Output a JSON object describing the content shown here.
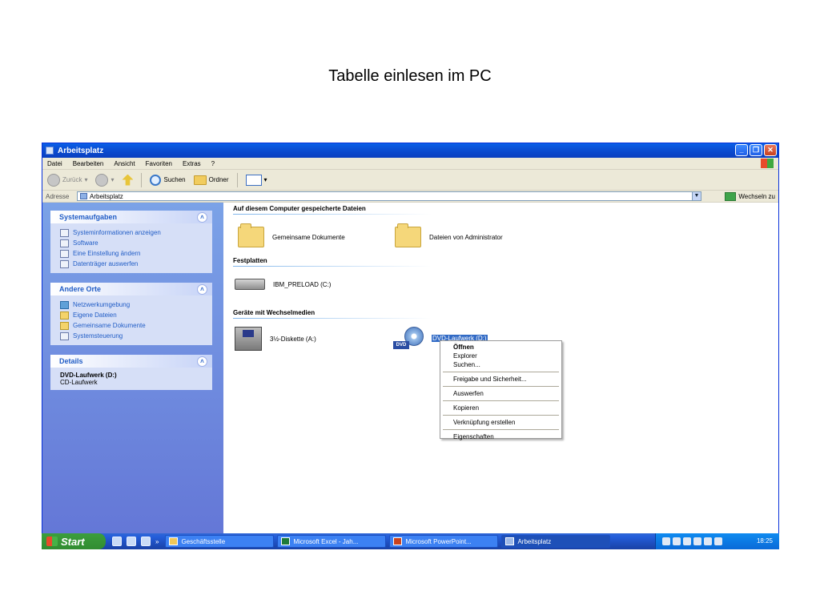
{
  "slide": {
    "title": "Tabelle einlesen im PC"
  },
  "window": {
    "title": "Arbeitsplatz",
    "menu": [
      "Datei",
      "Bearbeiten",
      "Ansicht",
      "Favoriten",
      "Extras",
      "?"
    ],
    "toolbar": {
      "back": "Zurück",
      "search": "Suchen",
      "folders": "Ordner"
    },
    "address": {
      "label": "Adresse",
      "value": "Arbeitsplatz",
      "go": "Wechseln zu"
    }
  },
  "sidebar": {
    "system_tasks": {
      "title": "Systemaufgaben",
      "items": [
        "Systeminformationen anzeigen",
        "Software",
        "Eine Einstellung ändern",
        "Datenträger auswerfen"
      ]
    },
    "other_places": {
      "title": "Andere Orte",
      "items": [
        "Netzwerkumgebung",
        "Eigene Dateien",
        "Gemeinsame Dokumente",
        "Systemsteuerung"
      ]
    },
    "details": {
      "title": "Details",
      "name": "DVD-Laufwerk (D:)",
      "type": "CD-Laufwerk"
    }
  },
  "content": {
    "groups": [
      {
        "title": "Auf diesem Computer gespeicherte Dateien",
        "items": [
          "Gemeinsame Dokumente",
          "Dateien von Administrator"
        ]
      },
      {
        "title": "Festplatten",
        "items": [
          "IBM_PRELOAD (C:)"
        ]
      },
      {
        "title": "Geräte mit Wechselmedien",
        "items": [
          "3½-Diskette (A:)",
          "DVD-Laufwerk (D:)"
        ]
      }
    ],
    "dvd_badge": "DVD"
  },
  "context_menu": {
    "items": [
      "Öffnen",
      "Explorer",
      "Suchen...",
      "Freigabe und Sicherheit...",
      "Auswerfen",
      "Kopieren",
      "Verknüpfung erstellen",
      "Eigenschaften"
    ]
  },
  "taskbar": {
    "start": "Start",
    "buttons": [
      "Geschäftsstelle",
      "Microsoft Excel - Jah...",
      "Microsoft PowerPoint...",
      "Arbeitsplatz"
    ],
    "clock": "18:25",
    "more": "»"
  },
  "colors": {
    "xp_blue": "#0a5fe8",
    "sidebar_top": "#7ba2e7",
    "selection": "#316ac5",
    "start_green": "#3c9e3c"
  }
}
